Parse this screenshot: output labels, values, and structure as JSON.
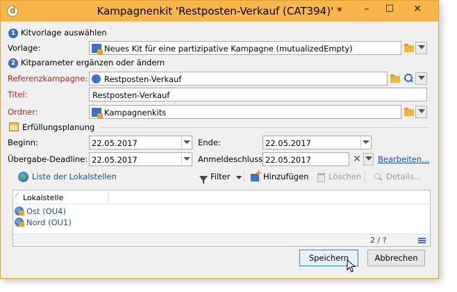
{
  "window": {
    "title": "Kampagnenkit 'Restposten-Verkauf  (CAT394)' *",
    "min_label": "–",
    "max_label": "☐",
    "close_label": "✕"
  },
  "section1": {
    "badge": "1",
    "title": "Kitvorlage auswählen",
    "vorlage_label": "Vorlage:",
    "vorlage_value": "Neues Kit für eine partizipative Kampagne (mutualizedEmpty)"
  },
  "section2": {
    "badge": "2",
    "title": "Kitparameter ergänzen oder ändern",
    "referenz_label": "Referenzkampagne:",
    "referenz_value": "Restposten-Verkauf",
    "titel_label": "Titel:",
    "titel_value": "Restposten-Verkauf",
    "ordner_label": "Ordner:",
    "ordner_value": "Kampagnenkits"
  },
  "planning": {
    "title": "Erfüllungsplanung",
    "beginn_label": "Beginn:",
    "beginn_value": "22.05.2017",
    "ende_label": "Ende:",
    "ende_value": "22.05.2017",
    "deadline_label": "Übergabe-Deadline:",
    "deadline_value": "22.05.2017",
    "anmelde_label": "Anmeldeschluss:",
    "anmelde_value": "22.05.2017",
    "clear_label": "✕",
    "edit_link": "Bearbeiten..."
  },
  "toolbar": {
    "list_label": "Liste der Lokalstellen",
    "filter_label": "Filter",
    "add_label": "Hinzufügen",
    "delete_label": "Löschen",
    "details_label": "Details..."
  },
  "grid": {
    "sort_mark": "⁄",
    "column": "Lokalstelle",
    "rows": [
      "Ost (OU4)",
      "Nord (OU1)"
    ],
    "pager": "2 / ?"
  },
  "buttons": {
    "save_label": "Speichern",
    "cancel_label": "Abbrechen"
  }
}
